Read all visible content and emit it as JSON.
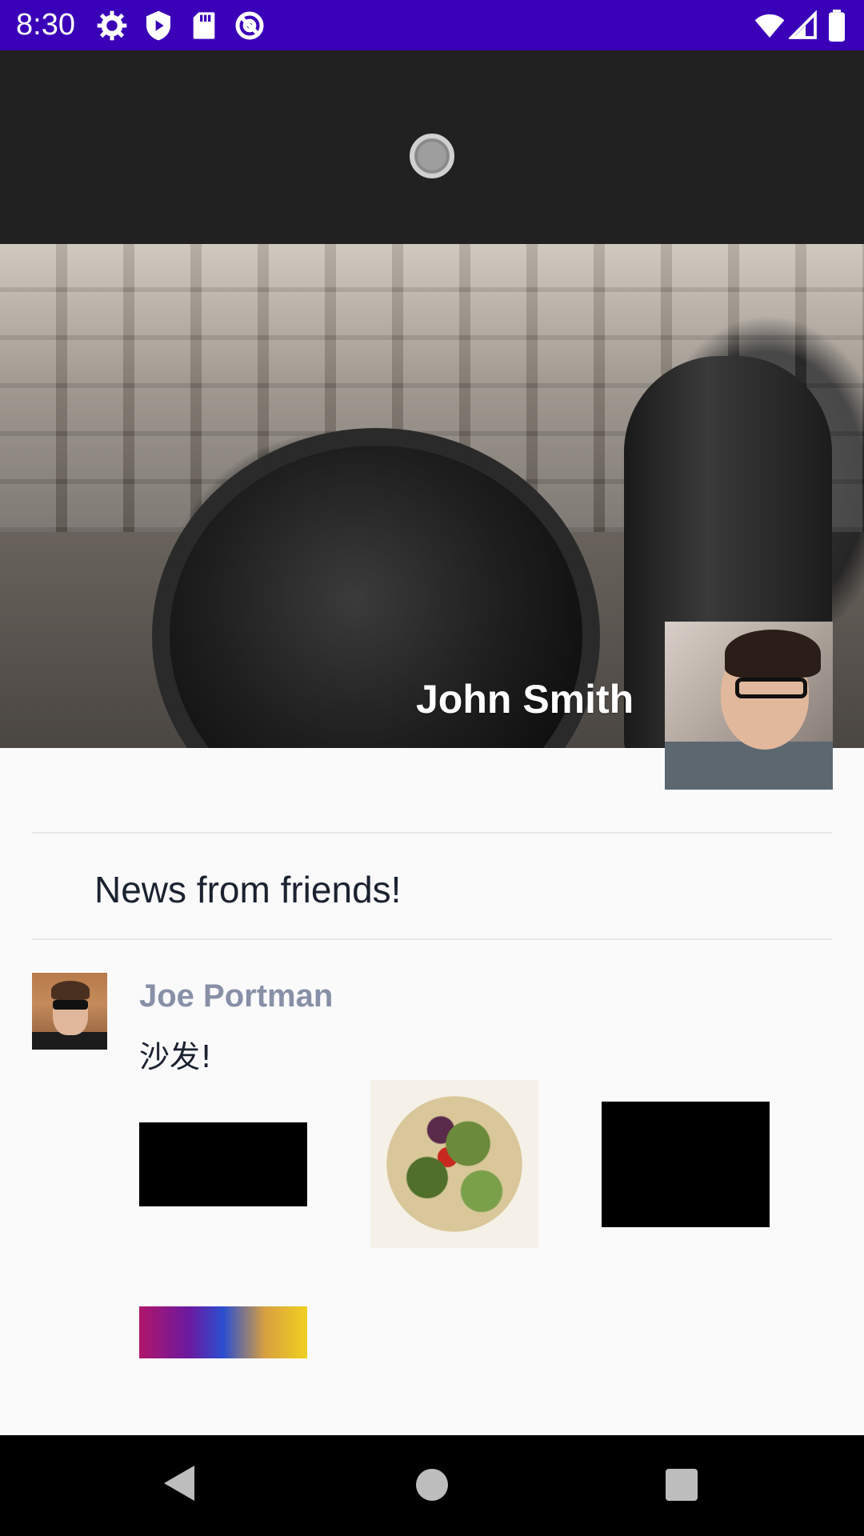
{
  "status_bar": {
    "time": "8:30",
    "left_icons": [
      "gear-icon",
      "play-protect-icon",
      "sd-card-icon",
      "at-sign-icon"
    ],
    "right_icons": [
      "wifi-icon",
      "signal-icon",
      "battery-icon"
    ],
    "background_color": "#3a00b8"
  },
  "toolbar": {
    "background_color": "#212121",
    "indicator": "loading-indicator-icon"
  },
  "profile_header": {
    "name": "John Smith"
  },
  "section": {
    "title": "News from friends!"
  },
  "feed": [
    {
      "author": "Joe Portman",
      "text": "沙发!",
      "photos": [
        "photo-1",
        "photo-2",
        "photo-3",
        "photo-4"
      ]
    }
  ],
  "colors": {
    "author_name": "#8790a7",
    "body_text": "#1b2230",
    "background": "#fafafa"
  }
}
